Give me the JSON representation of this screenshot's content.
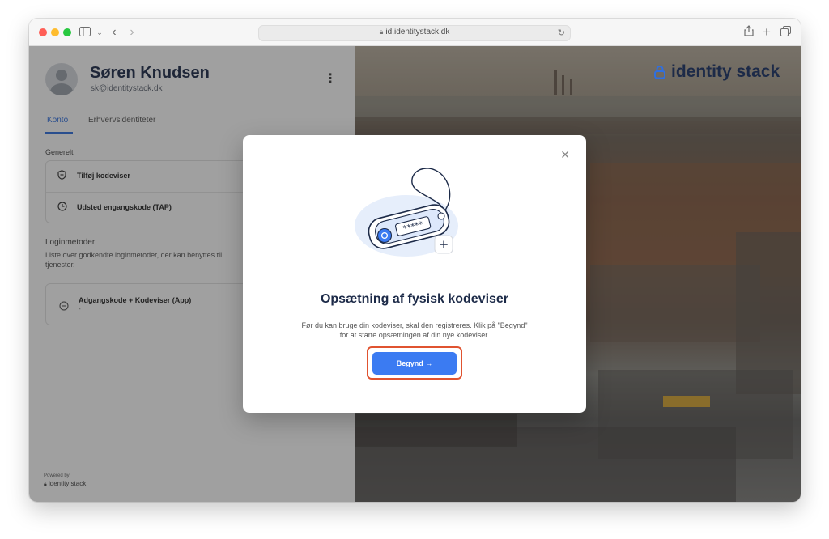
{
  "browser": {
    "url": "id.identitystack.dk",
    "traffic_lights": [
      "#ff5f57",
      "#febc2e",
      "#28c840"
    ]
  },
  "profile": {
    "name": "Søren Knudsen",
    "email": "sk@identitystack.dk"
  },
  "tabs": [
    {
      "label": "Konto",
      "active": true
    },
    {
      "label": "Erhvervsidentiteter",
      "active": false
    }
  ],
  "general": {
    "heading": "Generelt",
    "items": [
      {
        "label": "Tilføj kodeviser",
        "icon": "shield-icon"
      },
      {
        "label": "Udsted engangskode (TAP)",
        "icon": "clock-icon"
      }
    ]
  },
  "login_methods": {
    "heading": "Loginmetoder",
    "description": "Liste over godkendte loginmetoder, der kan benyttes til tjenester.",
    "items": [
      {
        "label": "Adgangskode + Kodeviser (App)",
        "sublabel": "-",
        "icon": "minus-circle-icon"
      }
    ]
  },
  "footer": {
    "powered_by": "Powered by",
    "brand": "identity stack"
  },
  "brand": {
    "name": "identity stack",
    "color": "#1c2a48"
  },
  "modal": {
    "title": "Opsætning af fysisk kodeviser",
    "body": "Før du kan bruge din kodeviser, skal den registreres. Klik på \"Begynd\" for at starte opsætningen af din nye kodeviser.",
    "cta_label": "Begynd",
    "cta_color": "#3b7bf2",
    "highlight_color": "#e05330",
    "device_display": "*****"
  }
}
